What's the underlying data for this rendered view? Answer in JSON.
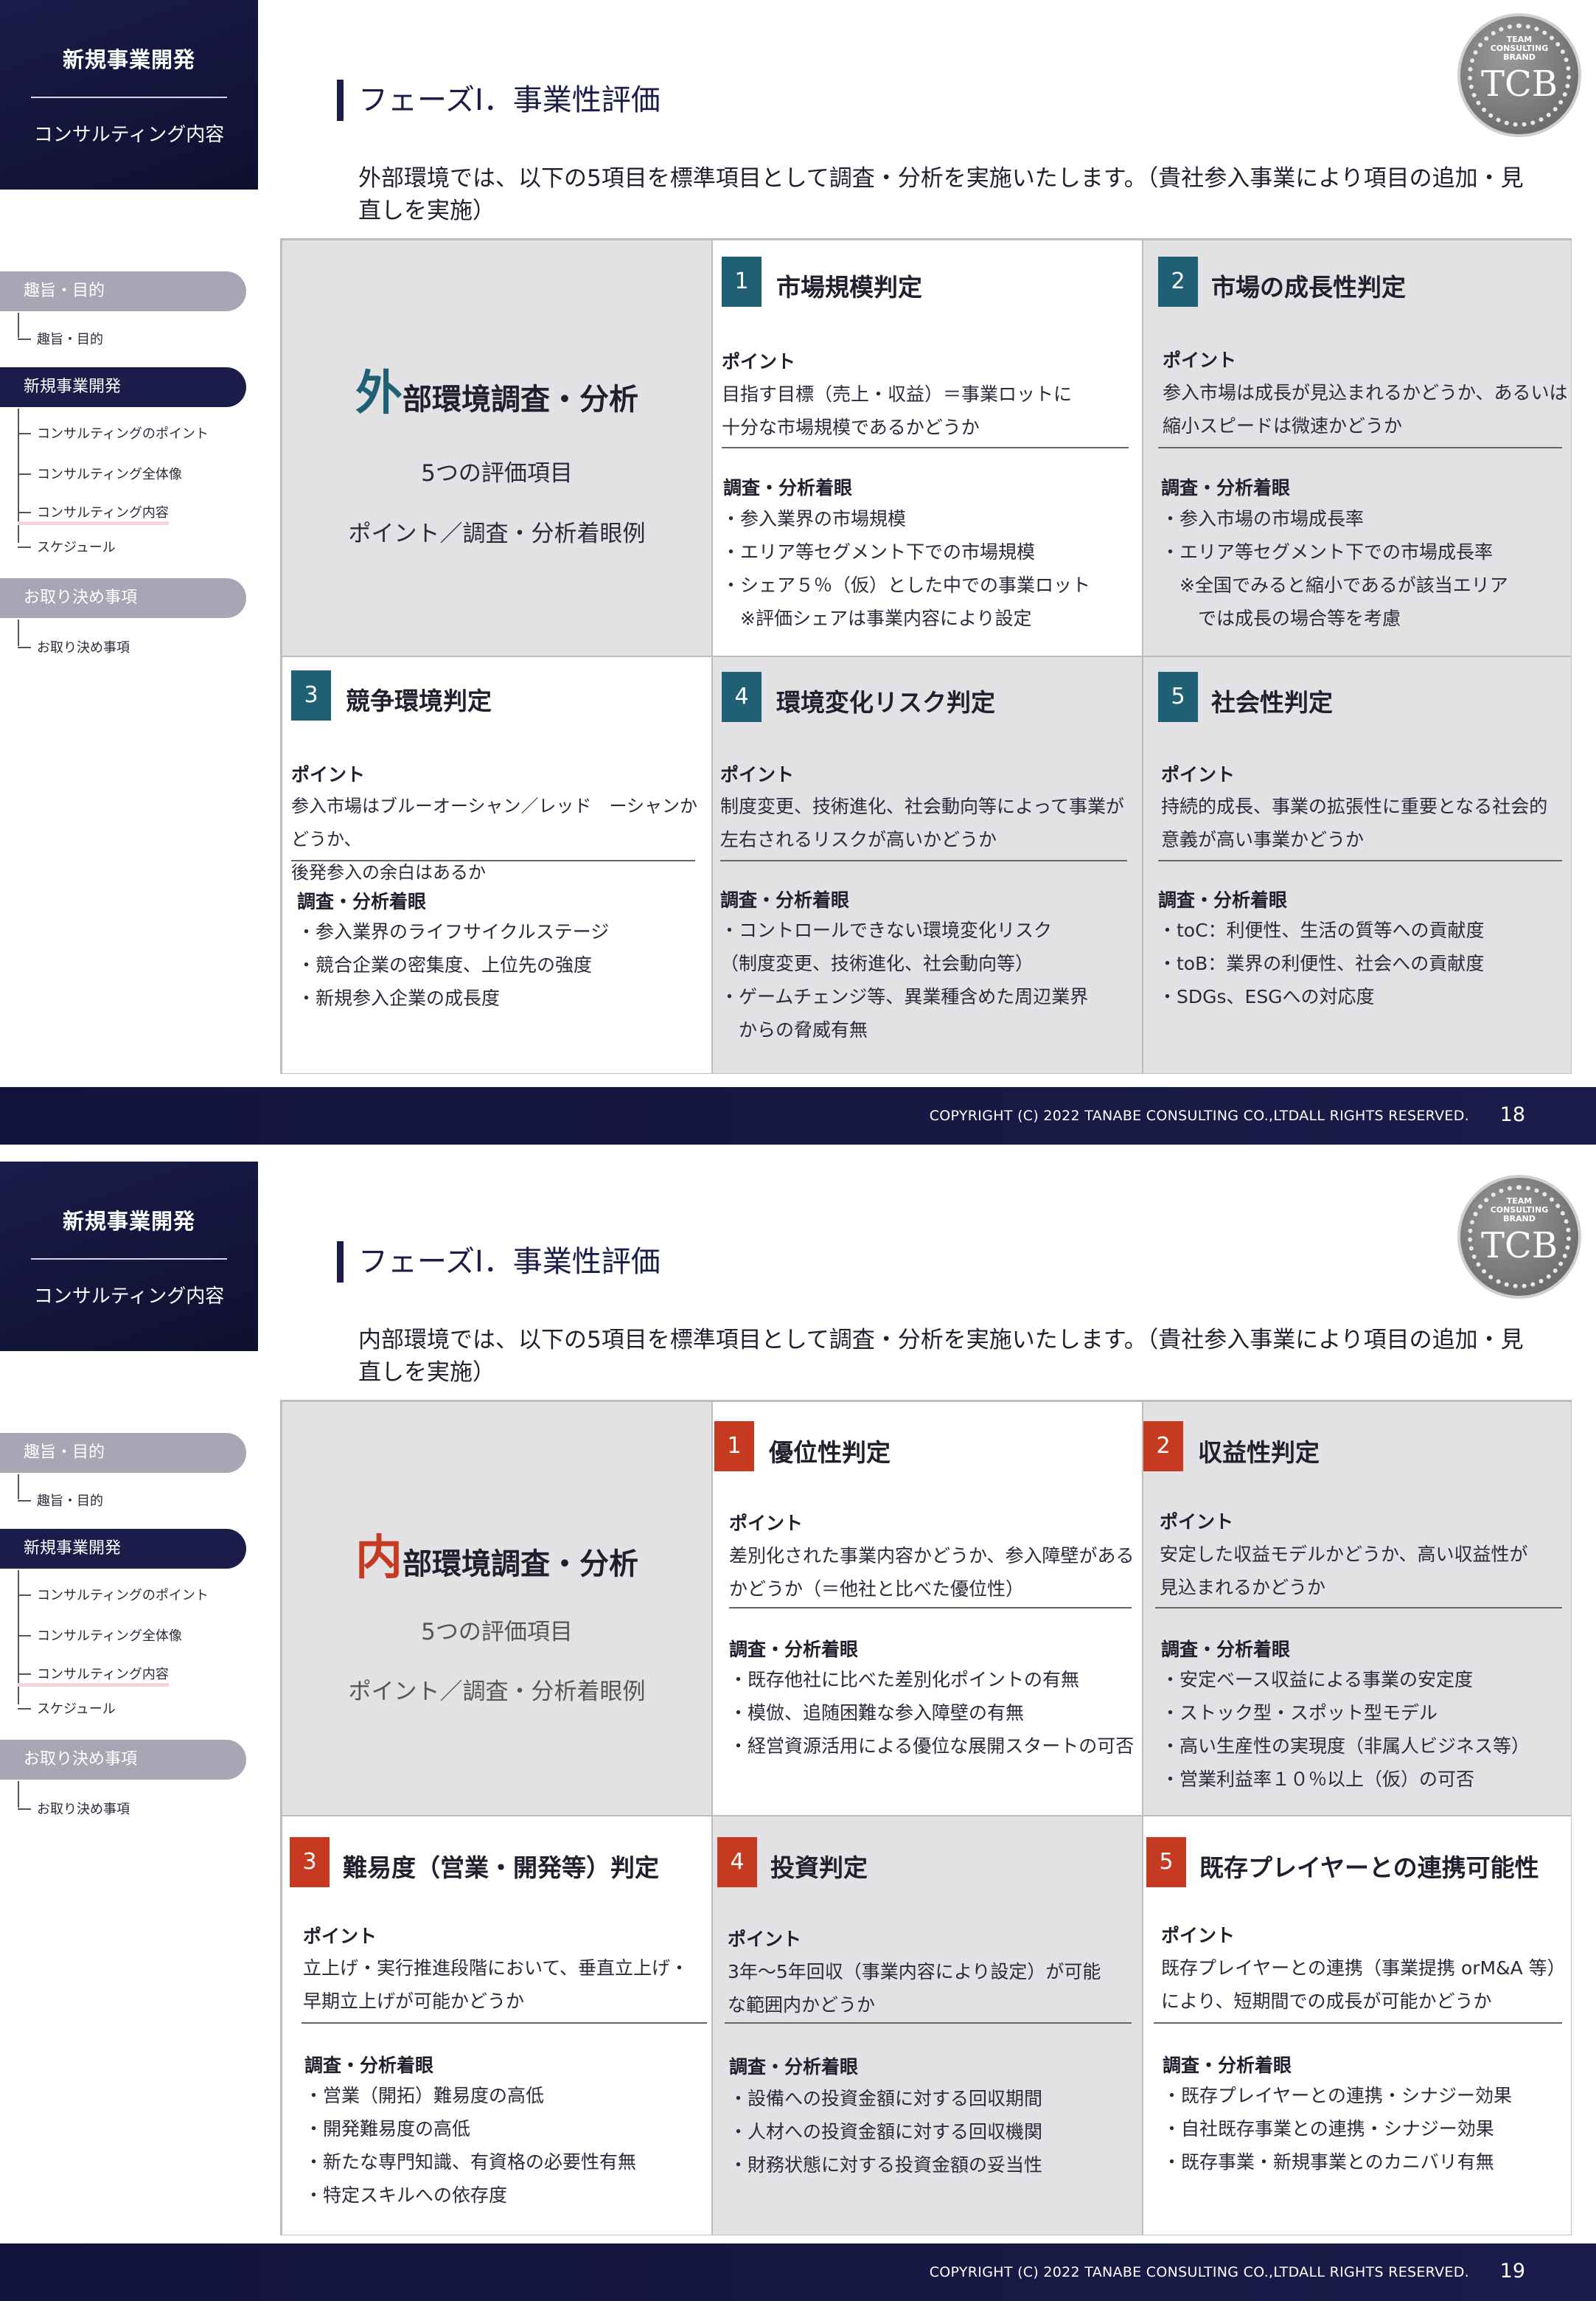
{
  "brand": {
    "title": "新規事業開発",
    "subtitle": "コンサルティング内容"
  },
  "nav": {
    "sec1": "趣旨・目的",
    "sec1_items": [
      "趣旨・目的"
    ],
    "sec2": "新規事業開発",
    "sec2_items": [
      "コンサルティングのポイント",
      "コンサルティング全体像",
      "コンサルティング内容",
      "スケジュール"
    ],
    "sec3": "お取り決め事項",
    "sec3_items": [
      "お取り決め事項"
    ]
  },
  "logo": {
    "small": "TEAM\nCONSULTING\nBRAND",
    "big": "TCB"
  },
  "colors": {
    "navy": "#1b1c4a",
    "teal": "#1f6075",
    "red": "#c73a22"
  },
  "copyright": "COPYRIGHT (C) 2022 TANABE CONSULTING CO.,LTDALL RIGHTS RESERVED.",
  "pages": [
    {
      "phase": "フェーズⅠ．事業性評価",
      "intro": "外部環境では、以下の5項目を標準項目として調査・分析を実施いたします。（貴社参入事業により項目の追加・見直しを実施）",
      "center": {
        "big_char": "外",
        "title_rest": "部環境調査・分析",
        "sub1": "5つの評価項目",
        "sub2": "ポイント／調査・分析着眼例"
      },
      "cells": [
        {
          "num": "1",
          "title": "市場規模判定",
          "point_label": "ポイント",
          "point": [
            "目指す目標（売上・収益）＝事業ロットに",
            "十分な市場規模であるかどうか"
          ],
          "check_label": "調査・分析着眼",
          "checks": [
            "・参入業界の市場規模",
            "・エリア等セグメント下での市場規模",
            "・シェア５％（仮）とした中での事業ロット",
            "　※評価シェアは事業内容により設定"
          ]
        },
        {
          "num": "2",
          "title": "市場の成長性判定",
          "point_label": "ポイント",
          "point": [
            "参入市場は成長が見込まれるかどうか、あるいは",
            "縮小スピードは微速かどうか"
          ],
          "check_label": "調査・分析着眼",
          "checks": [
            "・参入市場の市場成長率",
            "・エリア等セグメント下での市場成長率",
            "　※全国でみると縮小であるが該当エリア",
            "　　では成長の場合等を考慮"
          ]
        },
        {
          "num": "3",
          "title": "競争環境判定",
          "point_label": "ポイント",
          "point": [
            "参入市場はブルーオーシャン／レッド　ーシャンかどうか、",
            "後発参入の余白はあるか"
          ],
          "check_label": "調査・分析着眼",
          "checks": [
            "・参入業界のライフサイクルステージ",
            "・競合企業の密集度、上位先の強度",
            "・新規参入企業の成長度"
          ]
        },
        {
          "num": "4",
          "title": "環境変化リスク判定",
          "point_label": "ポイント",
          "point": [
            "制度変更、技術進化、社会動向等によって事業が",
            "左右されるリスクが高いかどうか"
          ],
          "check_label": "調査・分析着眼",
          "checks": [
            "・コントロールできない環境変化リスク",
            "（制度変更、技術進化、社会動向等）",
            "・ゲームチェンジ等、異業種含めた周辺業界",
            "　からの脅威有無"
          ]
        },
        {
          "num": "5",
          "title": "社会性判定",
          "point_label": "ポイント",
          "point": [
            "持続的成長、事業の拡張性に重要となる社会的",
            "意義が高い事業かどうか"
          ],
          "check_label": "調査・分析着眼",
          "checks": [
            "・toC：利便性、生活の質等への貢献度",
            "・toB：業界の利便性、社会への貢献度",
            "・SDGs、ESGへの対応度"
          ]
        }
      ],
      "page_no": "18"
    },
    {
      "phase": "フェーズⅠ．事業性評価",
      "intro": "内部環境では、以下の5項目を標準項目として調査・分析を実施いたします。（貴社参入事業により項目の追加・見直しを実施）",
      "center": {
        "big_char": "内",
        "title_rest": "部環境調査・分析",
        "sub1": "5つの評価項目",
        "sub2": "ポイント／調査・分析着眼例"
      },
      "cells": [
        {
          "num": "1",
          "title": "優位性判定",
          "point_label": "ポイント",
          "point": [
            "差別化された事業内容かどうか、参入障壁がある",
            "かどうか（＝他社と比べた優位性）"
          ],
          "check_label": "調査・分析着眼",
          "checks": [
            "・既存他社に比べた差別化ポイントの有無",
            "・模倣、追随困難な参入障壁の有無",
            "・経営資源活用による優位な展開スタートの可否"
          ]
        },
        {
          "num": "2",
          "title": "収益性判定",
          "point_label": "ポイント",
          "point": [
            "安定した収益モデルかどうか、高い収益性が",
            "見込まれるかどうか"
          ],
          "check_label": "調査・分析着眼",
          "checks": [
            "・安定ベース収益による事業の安定度",
            "・ストック型・スポット型モデル",
            "・高い生産性の実現度（非属人ビジネス等）",
            "・営業利益率１０％以上（仮）の可否"
          ]
        },
        {
          "num": "3",
          "title": "難易度（営業・開発等）判定",
          "point_label": "ポイント",
          "point": [
            "立上げ・実行推進段階において、垂直立上げ・",
            "早期立上げが可能かどうか"
          ],
          "check_label": "調査・分析着眼",
          "checks": [
            "・営業（開拓）難易度の高低",
            "・開発難易度の高低",
            "・新たな専門知識、有資格の必要性有無",
            "・特定スキルへの依存度"
          ]
        },
        {
          "num": "4",
          "title": "投資判定",
          "point_label": "ポイント",
          "point": [
            "3年～5年回収（事業内容により設定）が可能",
            "な範囲内かどうか"
          ],
          "check_label": "調査・分析着眼",
          "checks": [
            "・設備への投資金額に対する回収期間",
            "・人材への投資金額に対する回収機関",
            "・財務状態に対する投資金額の妥当性"
          ]
        },
        {
          "num": "5",
          "title": "既存プレイヤーとの連携可能性",
          "point_label": "ポイント",
          "point": [
            "既存プレイヤーとの連携（事業提携 orM&A 等）",
            "により、短期間での成長が可能かどうか"
          ],
          "check_label": "調査・分析着眼",
          "checks": [
            "・既存プレイヤーとの連携・シナジー効果",
            "・自社既存事業との連携・シナジー効果",
            "・既存事業・新規事業とのカニバリ有無"
          ]
        }
      ],
      "page_no": "19"
    }
  ]
}
